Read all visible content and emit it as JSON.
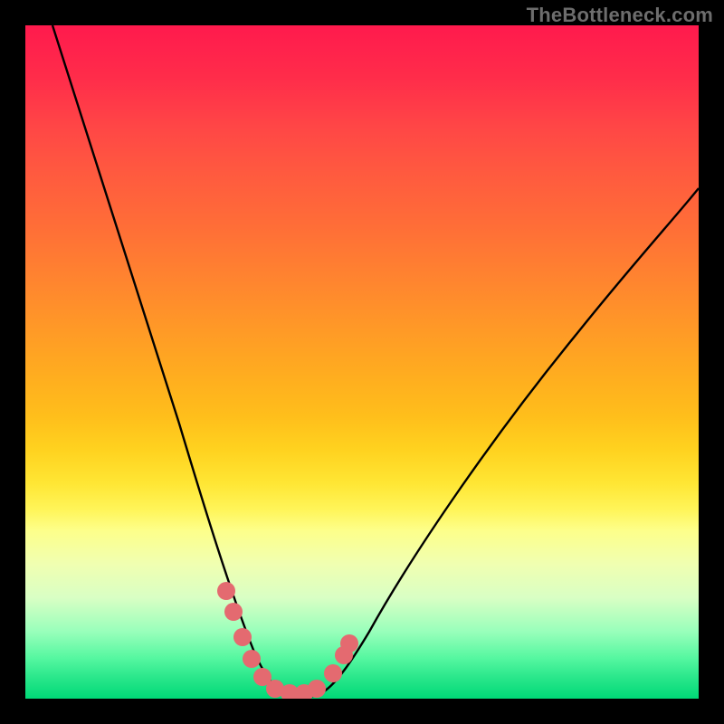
{
  "watermark": "TheBottleneck.com",
  "chart_data": {
    "type": "line",
    "title": "",
    "xlabel": "",
    "ylabel": "",
    "xlim": [
      0,
      100
    ],
    "ylim": [
      0,
      100
    ],
    "grid": false,
    "background": "rainbow-vertical-gradient",
    "series": [
      {
        "name": "bottleneck-curve",
        "color": "#000000",
        "x": [
          4,
          8,
          12,
          16,
          20,
          24,
          28,
          30,
          32,
          34,
          36,
          38,
          40,
          44,
          50,
          58,
          66,
          74,
          82,
          90,
          100
        ],
        "y": [
          100,
          84,
          70,
          57,
          45,
          33,
          22,
          17,
          12,
          8,
          5,
          3,
          2,
          2,
          5,
          12,
          22,
          33,
          45,
          55,
          68
        ]
      },
      {
        "name": "highlight-marks",
        "color": "#e46a70",
        "type": "scatter",
        "x": [
          27,
          28,
          30,
          32,
          34,
          36,
          38,
          40,
          42,
          44,
          46
        ],
        "y": [
          19,
          16,
          10,
          6,
          3,
          2,
          2,
          2,
          3,
          7,
          11
        ]
      }
    ]
  }
}
